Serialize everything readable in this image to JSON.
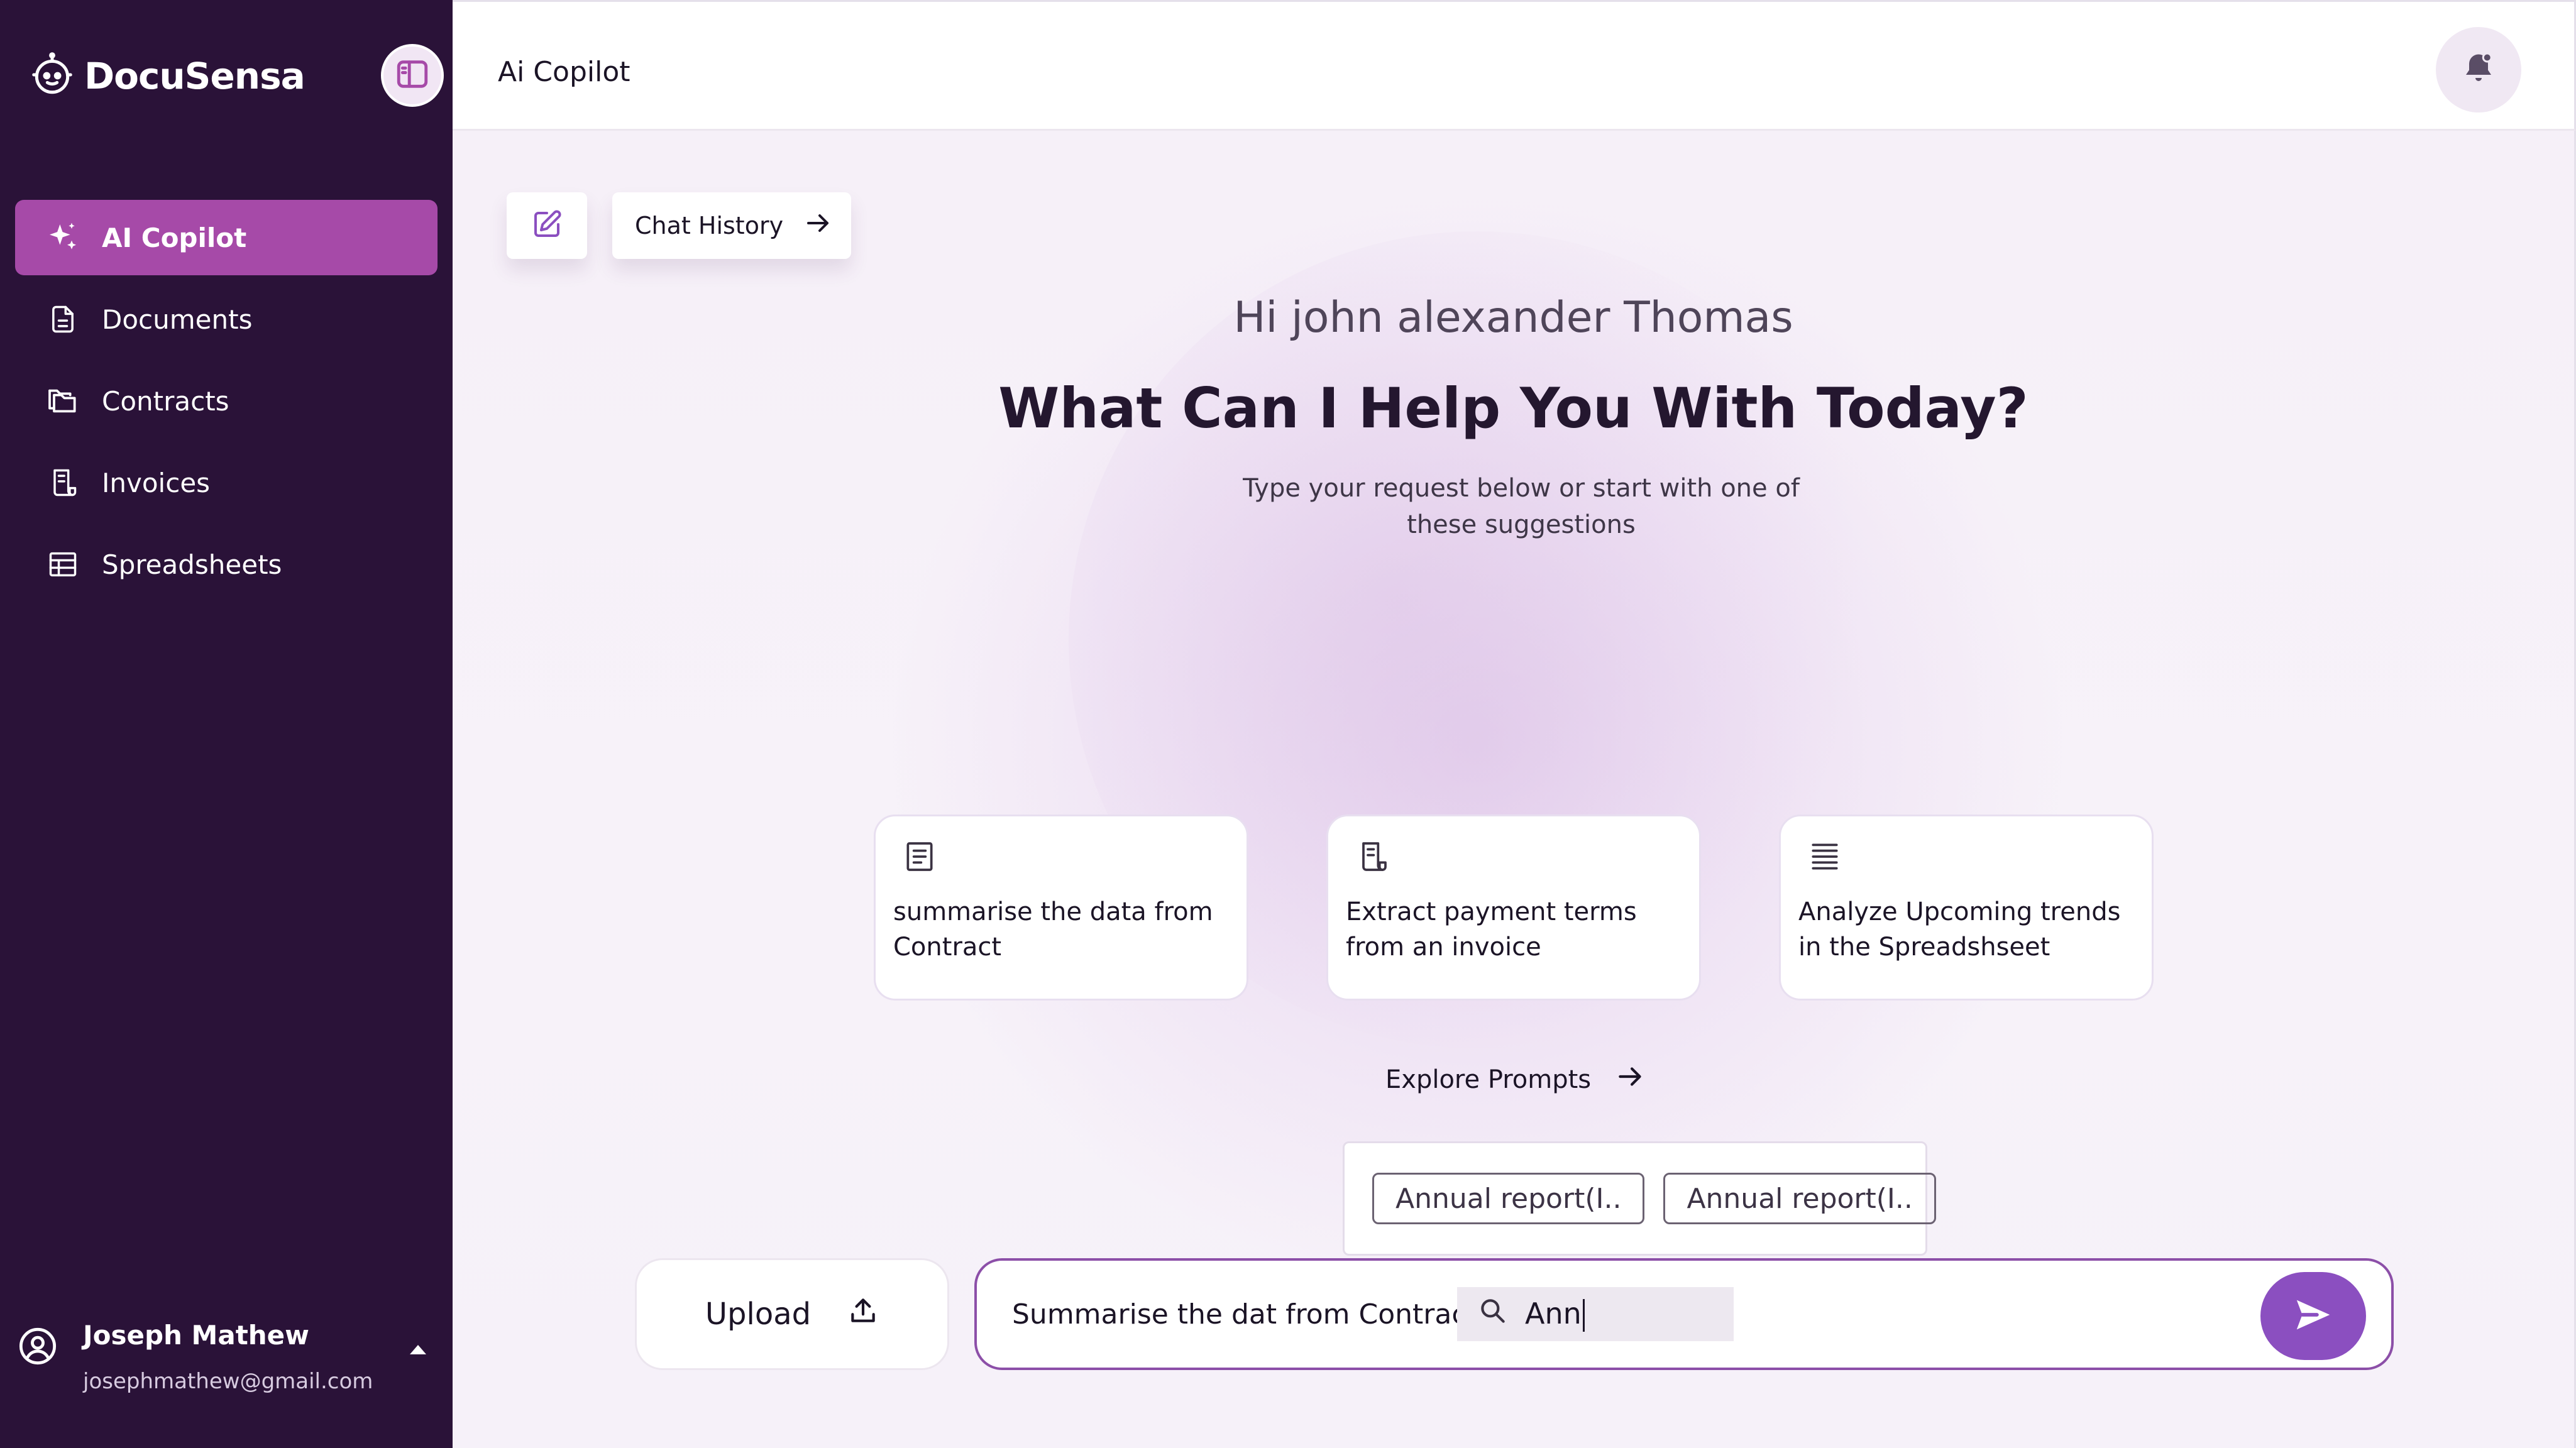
{
  "app": {
    "name": "DocuSensa"
  },
  "header": {
    "title": "Ai Copilot"
  },
  "sidebar": {
    "items": [
      {
        "label": "AI Copilot",
        "icon": "sparkle-icon",
        "active": true
      },
      {
        "label": "Documents",
        "icon": "document-icon",
        "active": false
      },
      {
        "label": "Contracts",
        "icon": "folder-icon",
        "active": false
      },
      {
        "label": "Invoices",
        "icon": "receipt-icon",
        "active": false
      },
      {
        "label": "Spreadsheets",
        "icon": "table-icon",
        "active": false
      }
    ],
    "user": {
      "name": "Joseph Mathew",
      "email": "josephmathew@gmail.com"
    }
  },
  "main": {
    "chat_history_label": "Chat History",
    "greeting": "Hi john alexander Thomas",
    "headline": "What Can I Help You With Today?",
    "subtext": "Type your request below  or start with one of these suggestions",
    "suggestions": [
      {
        "text": "summarise the data from Contract",
        "icon": "document-icon"
      },
      {
        "text": "Extract payment terms from an invoice",
        "icon": "receipt-icon"
      },
      {
        "text": "Analyze Upcoming trends in the Spreadshseet",
        "icon": "lines-icon"
      }
    ],
    "explore_label": "Explore Prompts",
    "mention_chips": [
      "Annual report(I..",
      "Annual report(I.."
    ],
    "upload_label": "Upload",
    "prompt_prefix": "Summarise the dat from Contract:",
    "mention_query": "Ann"
  },
  "colors": {
    "sidebar_bg": "#2a1238",
    "active_item": "#a64aa8",
    "accent": "#8b4fc0",
    "input_border": "#8c4fa8"
  }
}
